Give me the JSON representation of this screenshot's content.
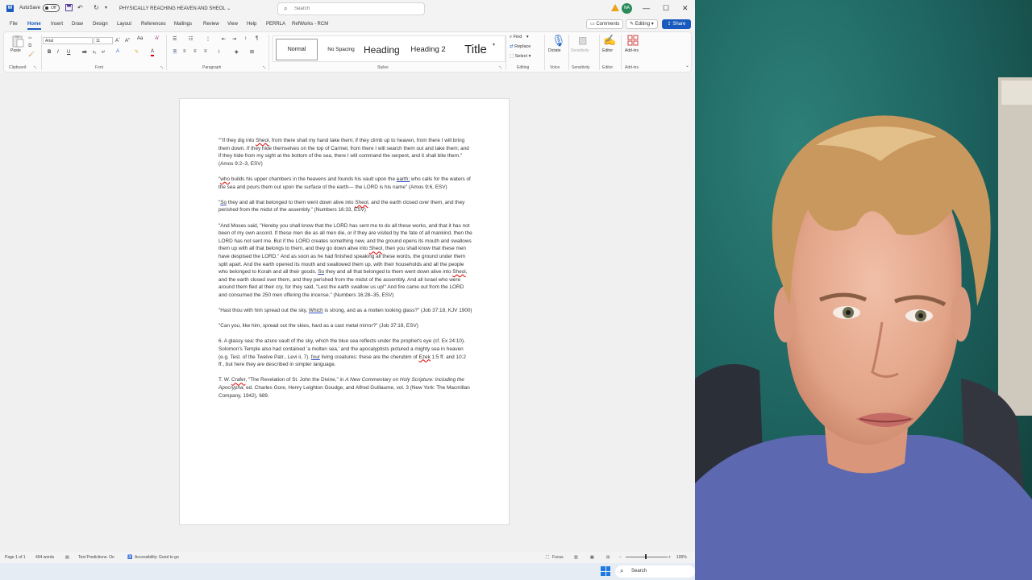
{
  "titlebar": {
    "app_logo": "W",
    "autosave_label": "AutoSave",
    "autosave_state": "Off",
    "document_title": "PHYSICALLY REACHING HEAVEN AND SHEOL",
    "document_title_suffix": "⌄",
    "search_placeholder": "Search",
    "avatar_initials": "NA",
    "icons": [
      "save-icon",
      "undo-icon",
      "redo-icon",
      "customize-icon",
      "warning-icon",
      "minimize-icon",
      "maximize-icon",
      "close-icon"
    ]
  },
  "tabs": [
    "File",
    "Home",
    "Insert",
    "Draw",
    "Design",
    "Layout",
    "References",
    "Mailings",
    "Review",
    "View",
    "Help",
    "PERRLA",
    "RefWorks - RCM"
  ],
  "active_tab": "Home",
  "top_actions": {
    "comments": "Comments",
    "editing": "Editing",
    "share": "Share"
  },
  "ribbon": {
    "clipboard": {
      "paste": "Paste",
      "label": "Clipboard"
    },
    "font": {
      "family": "Arial",
      "size": "11",
      "label": "Font",
      "bold": "B",
      "italic": "I",
      "underline": "U"
    },
    "paragraph": {
      "label": "Paragraph"
    },
    "styles": {
      "items": [
        "Normal",
        "No Spacing",
        "Heading 1",
        "Heading 2",
        "Title"
      ],
      "visible_items": [
        "Normal",
        "No Spacing",
        "Heading",
        "Heading 2",
        "Title"
      ],
      "label": "Styles"
    },
    "editing": {
      "find": "Find",
      "replace": "Replace",
      "select": "Select",
      "label": "Editing"
    },
    "voice": {
      "dictate": "Dictate",
      "label": "Voice"
    },
    "sensitivity": {
      "button": "Sensitivity",
      "label": "Sensitivity"
    },
    "editor": {
      "button": "Editor",
      "label": "Editor"
    },
    "addins": {
      "button": "Add-ins",
      "label": "Add-ins"
    }
  },
  "document": {
    "paragraphs": [
      {
        "parts": [
          {
            "t": "\"\"If they dig into "
          },
          {
            "t": "Sheol",
            "u": "red"
          },
          {
            "t": ", from there shall my hand take them; if they climb up to heaven, from there I will bring them down. If they hide themselves on the top of Carmel, from there I will search them out and take them; and if they hide from my sight at the bottom of the sea, there I will command the serpent, and it shall bite them.\" (Amos 9:2–3, ESV)"
          }
        ]
      },
      {
        "parts": [
          {
            "t": "\""
          },
          {
            "t": "who",
            "u": "red"
          },
          {
            "t": " builds his upper chambers in the heavens and founds his vault upon the "
          },
          {
            "t": "earth;",
            "u": "blue"
          },
          {
            "t": " who calls for the waters of the sea and pours them out upon the surface of the earth— the LORD is his name\" (Amos 9:6, ESV)"
          }
        ]
      },
      {
        "parts": [
          {
            "t": "\""
          },
          {
            "t": "So",
            "u": "blue"
          },
          {
            "t": " they and all that belonged to them went down alive into "
          },
          {
            "t": "Sheol",
            "u": "red"
          },
          {
            "t": ", and the earth closed over them, and they perished from the midst of the assembly.\" (Numbers 16:33, ESV)"
          }
        ]
      },
      {
        "parts": [
          {
            "t": "\"And Moses said, \"Hereby you shall know that the LORD has sent me to do all these works, and that it has not been of my own accord. If these men die as all men die, or if they are visited by the fate of all mankind, then the LORD has not sent me. But if the LORD creates something new, and the ground opens its mouth and swallows them up with all that belongs to them, and they go down alive into "
          },
          {
            "t": "Sheol",
            "u": "red"
          },
          {
            "t": ", then you shall know that these men have despised the LORD.\" And as soon as he had finished speaking all these words, the ground under them split apart. And the earth opened its mouth and swallowed them up, with their households and all the people who belonged to Korah and all their goods. "
          },
          {
            "t": "So",
            "u": "blue"
          },
          {
            "t": " they and all that belonged to them went down alive into "
          },
          {
            "t": "Sheol",
            "u": "red"
          },
          {
            "t": ", and the earth closed over them, and they perished from the midst of the assembly. And all Israel who were around them fled at their cry, for they said, \"Lest the earth swallow us up!\" And fire came out from the LORD and consumed the 250 men offering the incense.\" (Numbers 16:28–35, ESV)"
          }
        ]
      },
      {
        "parts": [
          {
            "t": "\"Hast thou with him spread out the sky, "
          },
          {
            "t": "Which",
            "u": "blue"
          },
          {
            "t": " is strong, and as a molten looking glass?\" (Job 37:18, KJV 1900)"
          }
        ]
      },
      {
        "parts": [
          {
            "t": "\"Can you, like him, spread out the skies, hard as a cast metal mirror?\" (Job 37:18, ESV)"
          }
        ]
      },
      {
        "parts": [
          {
            "t": "6. A glassy sea: the azure vault of the sky, which the blue sea reflects under the prophet's eye (cf. Ex 24:10). Solomon's Temple also had contained 'a molten sea,' and the apocalyptists pictured a mighty sea in heaven (e.g. Test. of the Twelve Patr., Levi ii, 7). "
          },
          {
            "t": "four",
            "u": "blue"
          },
          {
            "t": " living creatures: these are the cherubim of "
          },
          {
            "t": "Ezek",
            "u": "red"
          },
          {
            "t": " 1:5 ff. and 10:2 ff., but here they are described in simpler language."
          }
        ]
      },
      {
        "parts": [
          {
            "t": "T. W. "
          },
          {
            "t": "Crafer",
            "u": "red"
          },
          {
            "t": ", \"The Revelation of St. John the Divine,\" in "
          },
          {
            "t": "A New Commentary on Holy Scripture: Including the Apocrypha",
            "i": true
          },
          {
            "t": ", ed. Charles Gore, Henry Leighton Goudge, and Alfred Guillaume, vol. 3 (New York: The Macmillan Company, 1942), 689."
          }
        ]
      }
    ]
  },
  "statusbar": {
    "page": "Page 1 of 1",
    "words": "494 words",
    "text_predictions": "Text Predictions: On",
    "accessibility": "Accessibility: Good to go",
    "focus": "Focus",
    "zoom": "100%"
  },
  "taskbar": {
    "search_label": "Search"
  },
  "colors": {
    "word_blue": "#185abd",
    "canvas_gray": "#f0f0f0",
    "ribbon_bg": "#fbfbfb",
    "webcam_teal": "#1f6b68",
    "shirt_blue": "#5c68b0"
  }
}
